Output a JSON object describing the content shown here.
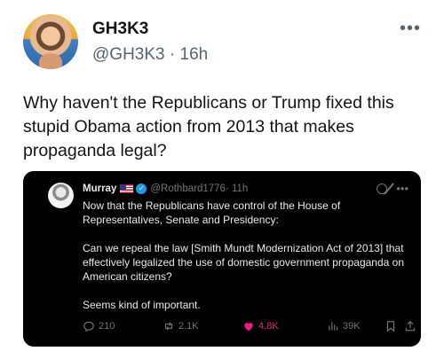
{
  "post": {
    "display_name": "GH3K3",
    "handle": "@GH3K3",
    "separator": " · ",
    "time": "16h",
    "text": "Why haven't the Republicans or Trump fixed this stupid Obama action from 2013 that makes propaganda legal?",
    "more_icon": "•••"
  },
  "quote": {
    "name": "Murray",
    "handle": "@Rothbard1776",
    "time": " · 11h",
    "more_icon": "•••",
    "paragraphs": [
      "Now that the Republicans have control of the House of Representatives, Senate and Presidency:",
      "Can we repeal the law [Smith Mundt Modernization Act of 2013] that effectively legalized the use of domestic government propaganda on American citizens?",
      "Seems kind of important."
    ],
    "actions": {
      "replies": "210",
      "reposts": "2.1K",
      "likes": "4.8K",
      "views": "39K"
    },
    "colors": {
      "like": "#f91880",
      "verified": "#1d9bf0",
      "card_bg": "#000000"
    }
  }
}
